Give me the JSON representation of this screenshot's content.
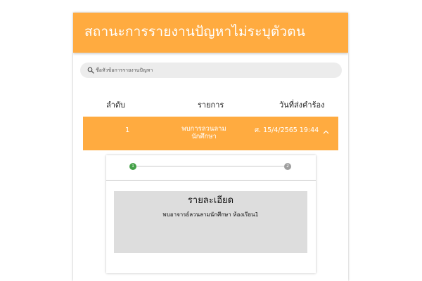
{
  "header": {
    "title": "สถานะการรายงานปัญหาไม่ระบุตัวตน"
  },
  "search": {
    "placeholder": "ชื่อหัวข้อการรายงานปัญหา",
    "icon": "search-icon"
  },
  "table": {
    "columns": [
      "ลำดับ",
      "รายการ",
      "วันที่ส่งคำร้อง"
    ],
    "rows": [
      {
        "order": "1",
        "item": "พบการลวนลามนักศึกษา",
        "date": "ศ. 15/4/2565 19:44",
        "expanded": true
      }
    ]
  },
  "stepper": {
    "steps": [
      "1",
      "2"
    ],
    "active_step": 1,
    "colors": {
      "active": "#43a047",
      "inactive": "#9e9e9e"
    }
  },
  "detail": {
    "title": "รายละเอียด",
    "text": "พบอาจารย์ลวนลามนักศึกษา ห้องเรียน1"
  },
  "colors": {
    "accent": "#ffab40",
    "header_text": "#ffffff"
  }
}
